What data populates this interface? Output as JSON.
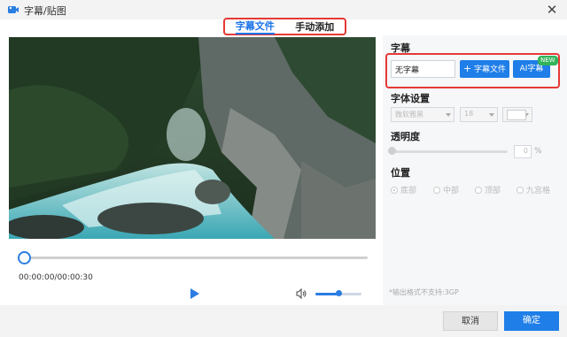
{
  "window": {
    "title": "字幕/贴图"
  },
  "tabs": [
    {
      "label": "字幕文件",
      "active": true
    },
    {
      "label": "手动添加",
      "active": false
    }
  ],
  "player": {
    "time": "00:00:00/00:00:30",
    "progress": 0.0,
    "volume": 0.5
  },
  "subtitle": {
    "title": "字幕",
    "input_value": "无字幕",
    "file_button": "字幕文件",
    "ai_button": "AI字幕",
    "ai_badge": "NEW"
  },
  "font": {
    "title": "字体设置",
    "family": "微软雅黑",
    "size": "18"
  },
  "opacity": {
    "title": "透明度",
    "value": "0",
    "unit": "%"
  },
  "position": {
    "title": "位置",
    "options": [
      {
        "label": "底部",
        "checked": true
      },
      {
        "label": "中部",
        "checked": false
      },
      {
        "label": "顶部",
        "checked": false
      },
      {
        "label": "九宫格",
        "checked": false
      }
    ]
  },
  "note": "*输出格式不支持:3GP",
  "footer": {
    "cancel": "取消",
    "ok": "确定"
  },
  "colors": {
    "accent": "#1f7ee8",
    "highlight": "#e53935",
    "badge": "#31b45a"
  }
}
